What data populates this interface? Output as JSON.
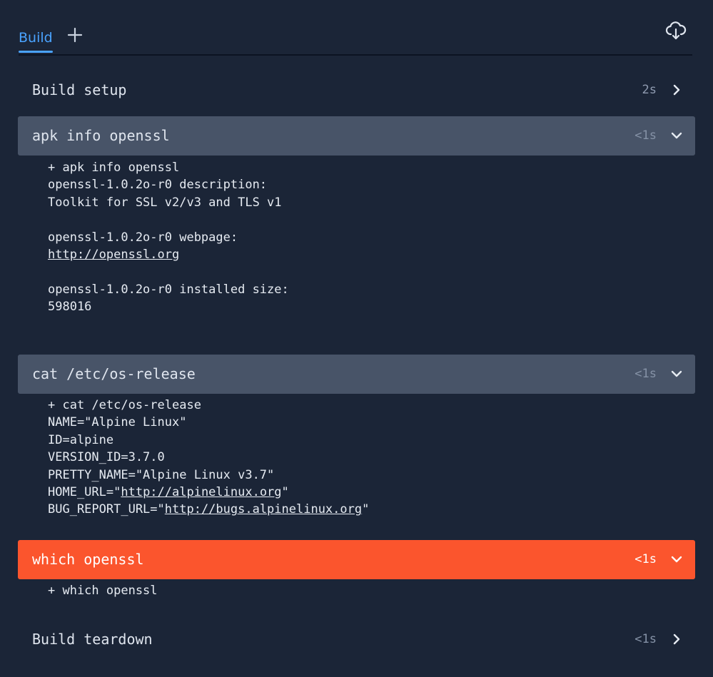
{
  "tabs": {
    "build_label": "Build"
  },
  "colors": {
    "background": "#1b2537",
    "active_tab": "#4aa3ff",
    "expanded_step": "#485468",
    "failed_step": "#fb552d"
  },
  "icons": {
    "add": "plus-icon",
    "download": "cloud-download-icon",
    "expand": "chevron-down-icon",
    "collapse": "chevron-right-icon"
  },
  "steps": [
    {
      "title": "Build setup",
      "duration": "2s",
      "state": "collapsed"
    },
    {
      "title": "apk info openssl",
      "duration": "<1s",
      "state": "expanded",
      "log": {
        "l1": "+ apk info openssl",
        "l2": "openssl-1.0.2o-r0 description:",
        "l3": "Toolkit for SSL v2/v3 and TLS v1",
        "l5": "openssl-1.0.2o-r0 webpage:",
        "l6_link": "http://openssl.org",
        "l8": "openssl-1.0.2o-r0 installed size:",
        "l9": "598016"
      }
    },
    {
      "title": "cat /etc/os-release",
      "duration": "<1s",
      "state": "expanded",
      "log": {
        "l1": "+ cat /etc/os-release",
        "l2": "NAME=\"Alpine Linux\"",
        "l3": "ID=alpine",
        "l4": "VERSION_ID=3.7.0",
        "l5": "PRETTY_NAME=\"Alpine Linux v3.7\"",
        "l6_prefix": "HOME_URL=\"",
        "l6_link": "http://alpinelinux.org",
        "l6_suffix": "\"",
        "l7_prefix": "BUG_REPORT_URL=\"",
        "l7_link": "http://bugs.alpinelinux.org",
        "l7_suffix": "\""
      }
    },
    {
      "title": "which openssl",
      "duration": "<1s",
      "state": "failed",
      "log": {
        "l1": "+ which openssl"
      }
    },
    {
      "title": "Build teardown",
      "duration": "<1s",
      "state": "collapsed"
    }
  ]
}
